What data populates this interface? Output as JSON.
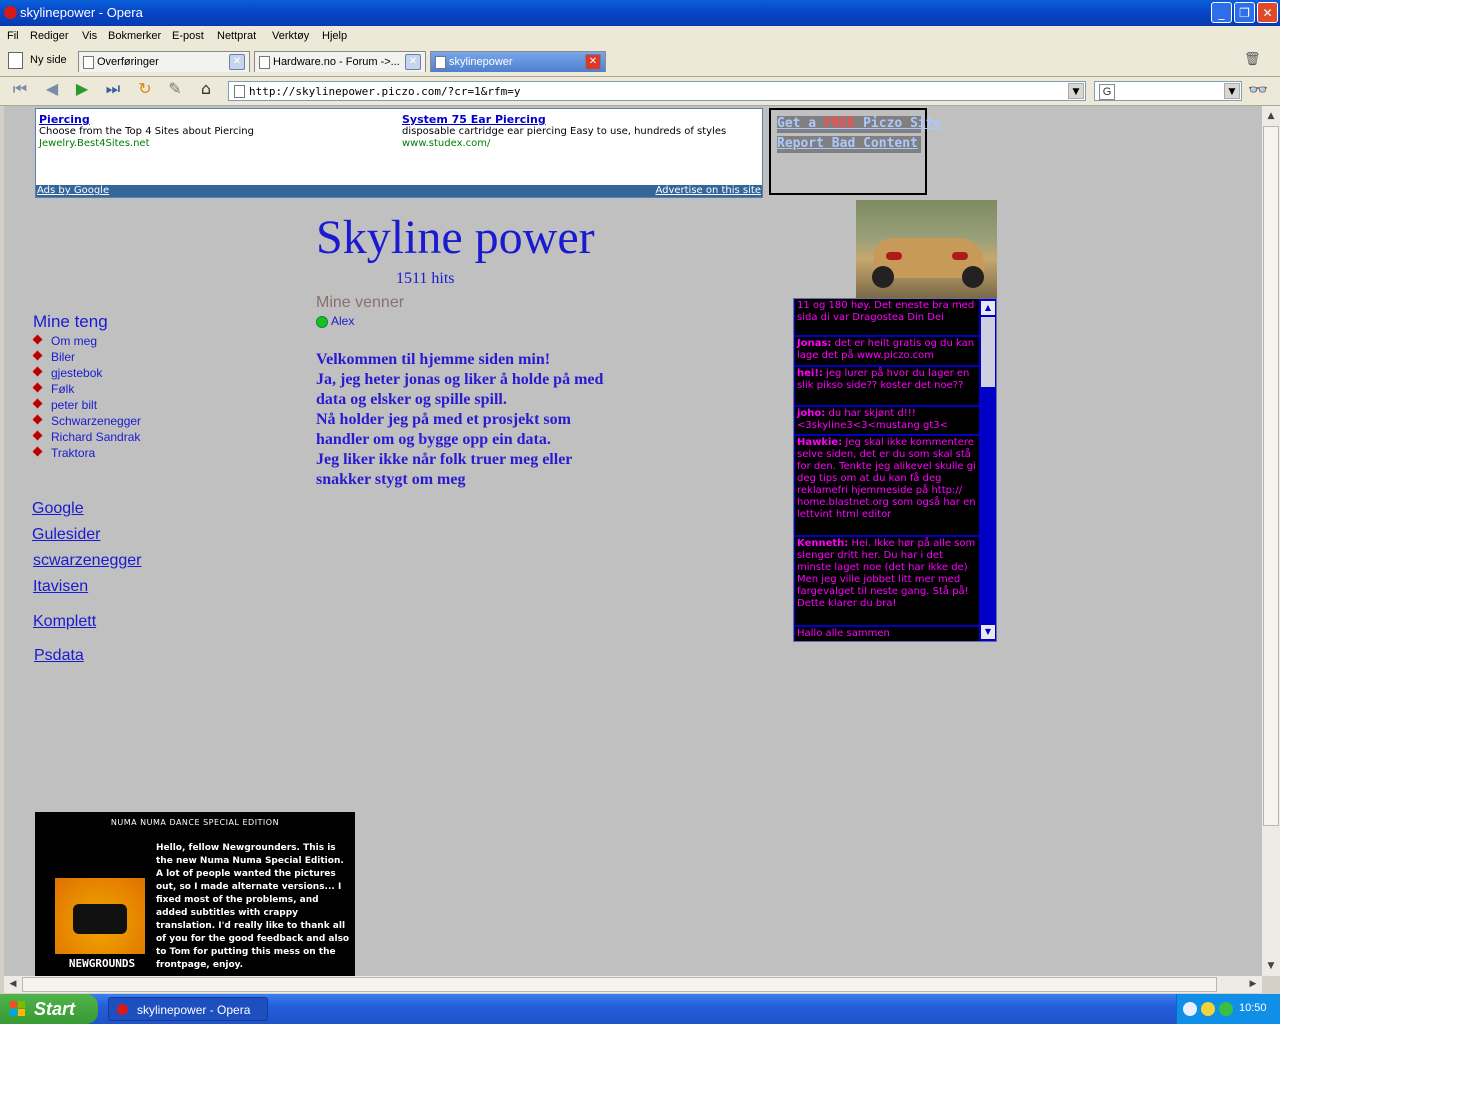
{
  "window": {
    "title": "skylinepower - Opera"
  },
  "menu": [
    "Fil",
    "Rediger",
    "Vis",
    "Bokmerker",
    "E-post",
    "Nettprat",
    "Verktøy",
    "Hjelp"
  ],
  "tabs": {
    "new_page": "Ny side",
    "items": [
      {
        "label": "Overføringer"
      },
      {
        "label": "Hardware.no - Forum ->..."
      },
      {
        "label": "skylinepower"
      }
    ]
  },
  "address": {
    "url": "http://skylinepower.piczo.com/?cr=1&rfm=y"
  },
  "search": {
    "engine": "G"
  },
  "ads": {
    "items": [
      {
        "title": "Piercing",
        "desc": "Choose from the Top 4 Sites about Piercing",
        "url": "Jewelry.Best4Sites.net"
      },
      {
        "title": "System 75 Ear Piercing",
        "desc": "disposable cartridge ear piercing Easy to use, hundreds of styles",
        "url": "www.studex.com/"
      }
    ],
    "by": "Ads by Google",
    "advertise": "Advertise on this site"
  },
  "piczo": {
    "get_pre": "Get a ",
    "get_free": "FREE",
    "get_post": " Piczo Site",
    "report": "Report Bad Content"
  },
  "page": {
    "title": "Skyline power",
    "hits": "1511 hits",
    "friends_heading": "Mine venner",
    "friend": "Alex",
    "welcome": [
      "Velkommen til hjemme siden min!",
      "Ja, jeg heter jonas og liker å holde på med",
      "data og elsker og spille spill.",
      "Nå holder jeg på med et prosjekt som",
      "handler om og bygge opp ein data.",
      "Jeg liker ikke når folk truer meg eller",
      "snakker stygt om meg"
    ]
  },
  "sidebar": {
    "heading": "Mine teng",
    "items": [
      "Om meg",
      "Biler",
      "gjestebok",
      "Følk",
      "peter bilt",
      "Schwarzenegger",
      "Richard Sandrak",
      "Traktora"
    ],
    "links": [
      "Google",
      "Gulesider ",
      "scwarzenegger ",
      "Itavisen ",
      "Komplett ",
      "Psdata "
    ]
  },
  "guestbook": [
    {
      "name": "",
      "text": "11 og 180 høy. Det eneste bra med sida di var Dragostea Din Dei"
    },
    {
      "name": "Jonas:",
      "text": " det er heilt gratis og du kan lage det på www.piczo.com"
    },
    {
      "name": "hei!:",
      "text": " jeg lurer på hvor du lager en slik pikso side?? koster det noe??"
    },
    {
      "name": "joho:",
      "text": " du har skjønt d!!! <3skyline3<3<mustang gt3<"
    },
    {
      "name": "Hawkie:",
      "text": " Jeg skal ikke kommentere selve siden, det er du som skal stå for den. Tenkte jeg alikevel skulle gi deg tips om at du kan få deg reklamefri hjemmeside på http:// home.blastnet.org   som også har en lettvint html editor"
    },
    {
      "name": "Kenneth:",
      "text": " Hei. Ikke hør på alle som slenger dritt her. Du har i det minste laget noe (det har ikke de) Men jeg ville jobbet litt mer med fargevalget til neste gang. Stå på! Dette klarer du bra!"
    },
    {
      "name": "",
      "text": "Hallo alle sammen"
    }
  ],
  "newgrounds": {
    "header": "NUMA NUMA DANCE     SPECIAL EDITION",
    "text": "Hello, fellow Newgrounders.  This is the new Numa Numa Special Edition.  A lot of people wanted the pictures out, so I made alternate versions... I fixed most of the problems, and added subtitles with crappy translation.  I'd really like to thank all of you for the good feedback and also to Tom for putting this mess on the frontpage, enjoy.",
    "logo": "NEWGROUNDS"
  },
  "taskbar": {
    "start": "Start",
    "task": "skylinepower - Opera",
    "clock": "10:50"
  },
  "colors": {
    "title_blue": "#1a1ad0",
    "guestbook_bg": "#000000",
    "guestbook_text": "#ff00ff",
    "page_bg": "#c0c0c0"
  }
}
